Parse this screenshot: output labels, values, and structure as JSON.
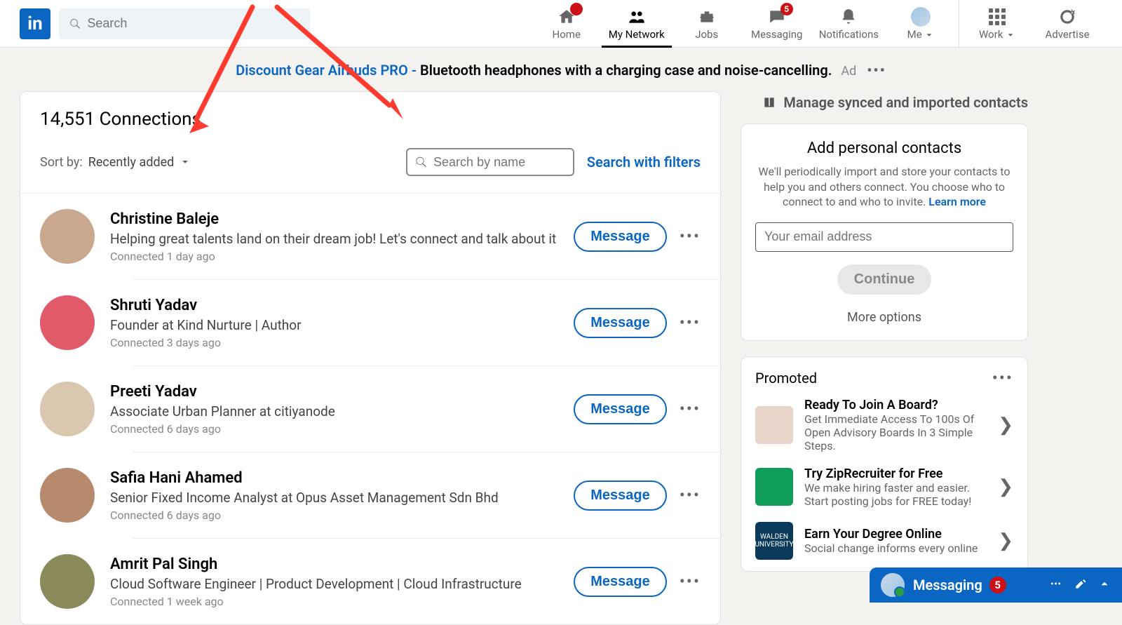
{
  "search": {
    "placeholder": "Search"
  },
  "nav": {
    "home": "Home",
    "network": "My Network",
    "jobs": "Jobs",
    "messaging": "Messaging",
    "notifications": "Notifications",
    "me": "Me",
    "work": "Work",
    "advertise": "Advertise",
    "messaging_badge": "5"
  },
  "ad": {
    "link": "Discount Gear Airbuds PRO - ",
    "rest": "Bluetooth headphones with a charging case and noise-cancelling.",
    "label": "Ad"
  },
  "main": {
    "title": "14,551 Connections",
    "sort_label": "Sort by:",
    "sort_value": "Recently added",
    "name_placeholder": "Search by name",
    "filters": "Search with filters",
    "message_btn": "Message"
  },
  "connections": [
    {
      "name": "Christine Baleje",
      "tag": "Helping great talents land on their dream job! Let's connect and talk about it",
      "time": "Connected 1 day ago"
    },
    {
      "name": "Shruti Yadav",
      "tag": "Founder at Kind Nurture | Author",
      "time": "Connected 3 days ago"
    },
    {
      "name": "Preeti Yadav",
      "tag": "Associate Urban Planner at citiyanode",
      "time": "Connected 6 days ago"
    },
    {
      "name": "Safia Hani Ahamed",
      "tag": "Senior Fixed Income Analyst at Opus Asset Management Sdn Bhd",
      "time": "Connected 6 days ago"
    },
    {
      "name": "Amrit Pal Singh",
      "tag": "Cloud Software Engineer | Product Development | Cloud Infrastructure",
      "time": "Connected 1 week ago"
    }
  ],
  "manage_link": "Manage synced and imported contacts",
  "contacts_card": {
    "title": "Add personal contacts",
    "sub": "We'll periodically import and store your contacts to help you and others connect. You choose who to connect to and who to invite. ",
    "learn": "Learn more",
    "placeholder": "Your email address",
    "continue": "Continue",
    "more": "More options"
  },
  "promoted": {
    "header": "Promoted",
    "items": [
      {
        "title": "Ready To Join A Board?",
        "desc": "Get Immediate Access To 100s Of Open Advisory Boards In 3 Simple Steps.",
        "color": "#e8d5c9"
      },
      {
        "title": "Try ZipRecruiter for Free",
        "desc": "We make hiring faster and easier. Start posting jobs for FREE today!",
        "color": "#0f9d58"
      },
      {
        "title": "Earn Your Degree Online",
        "desc": "Social change informs every online",
        "color": "#0a3a5a",
        "label": "WALDEN\nUNIVERSITY"
      }
    ]
  },
  "dock": {
    "title": "Messaging",
    "badge": "5"
  },
  "avatar_colors": [
    "#c9a88d",
    "#e05a6a",
    "#d9c7b0",
    "#b88a6d",
    "#8a8a5a"
  ]
}
